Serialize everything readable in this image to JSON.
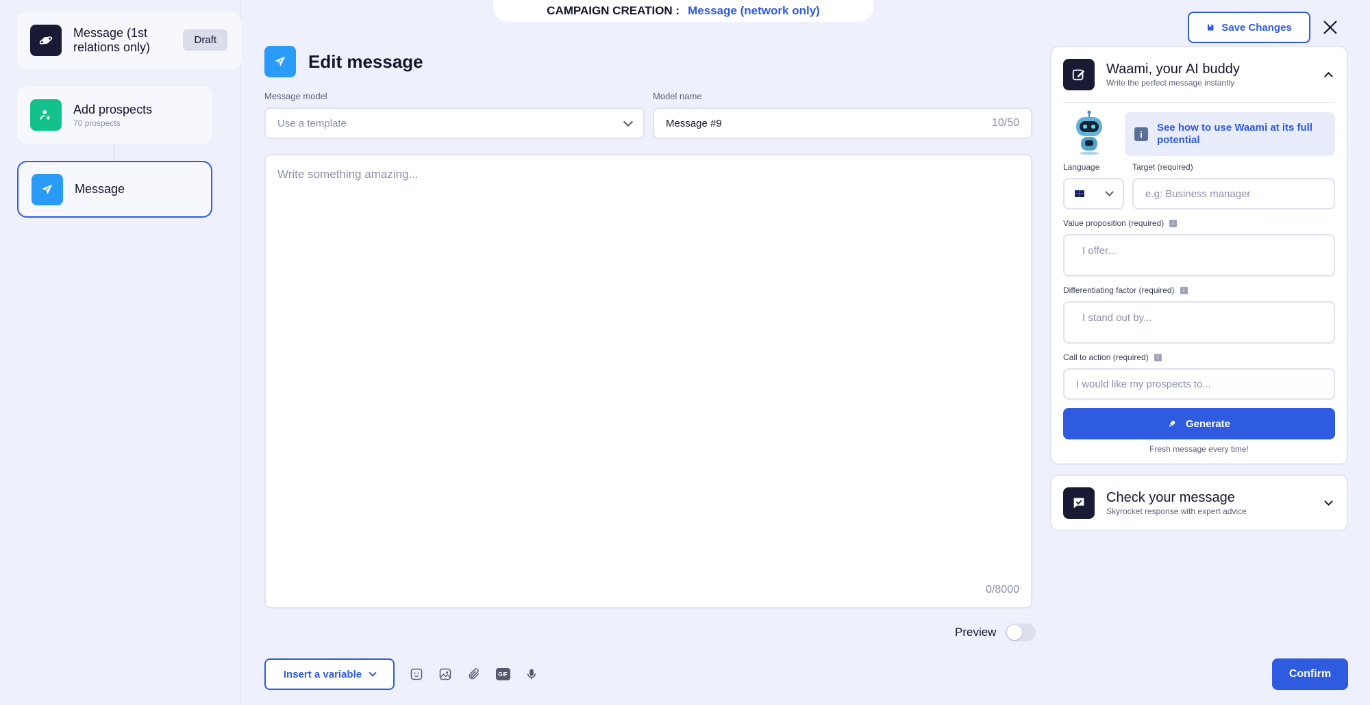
{
  "banner": {
    "label": "CAMPAIGN CREATION :",
    "value": "Message (network only)"
  },
  "steps": {
    "campaign": {
      "title": "Message (1st relations only)",
      "badge": "Draft"
    },
    "prospects": {
      "title": "Add prospects",
      "sub": "70 prospects"
    },
    "message": {
      "title": "Message"
    }
  },
  "editor": {
    "title": "Edit message",
    "model_label": "Message model",
    "model_placeholder": "Use a template",
    "name_label": "Model name",
    "name_value": "Message #9",
    "name_count": "10/50",
    "body_placeholder": "Write something amazing...",
    "body_count": "0/8000",
    "preview_label": "Preview",
    "insert_label": "Insert a variable",
    "toolbar_icons": [
      "emoji-icon",
      "image-icon",
      "attachment-icon",
      "gif-icon",
      "microphone-icon"
    ],
    "toolbar_gif": "GIF",
    "confirm_label": "Confirm"
  },
  "header": {
    "save_label": "Save Changes"
  },
  "waami": {
    "title": "Waami, your AI buddy",
    "subtitle": "Write the perfect message instantly",
    "info": "See how to use Waami at its full potential",
    "language_label": "Language",
    "target_label": "Target (required)",
    "target_placeholder": "e.g: Business manager",
    "value_label": "Value proposition (required)",
    "value_placeholder": "I offer...",
    "diff_label": "Differentiating factor (required)",
    "diff_placeholder": "I stand out by...",
    "cta_label": "Call to action (required)",
    "cta_placeholder": "I would like my prospects to...",
    "generate_label": "Generate",
    "footer": "Fresh message every time!"
  },
  "check": {
    "title": "Check your message",
    "subtitle": "Skyrocket response with expert advice"
  },
  "colors": {
    "accent": "#2f5be0",
    "dark": "#181b33",
    "green": "#12c28a",
    "sky": "#2a9cf7",
    "background": "#eef0fb"
  }
}
